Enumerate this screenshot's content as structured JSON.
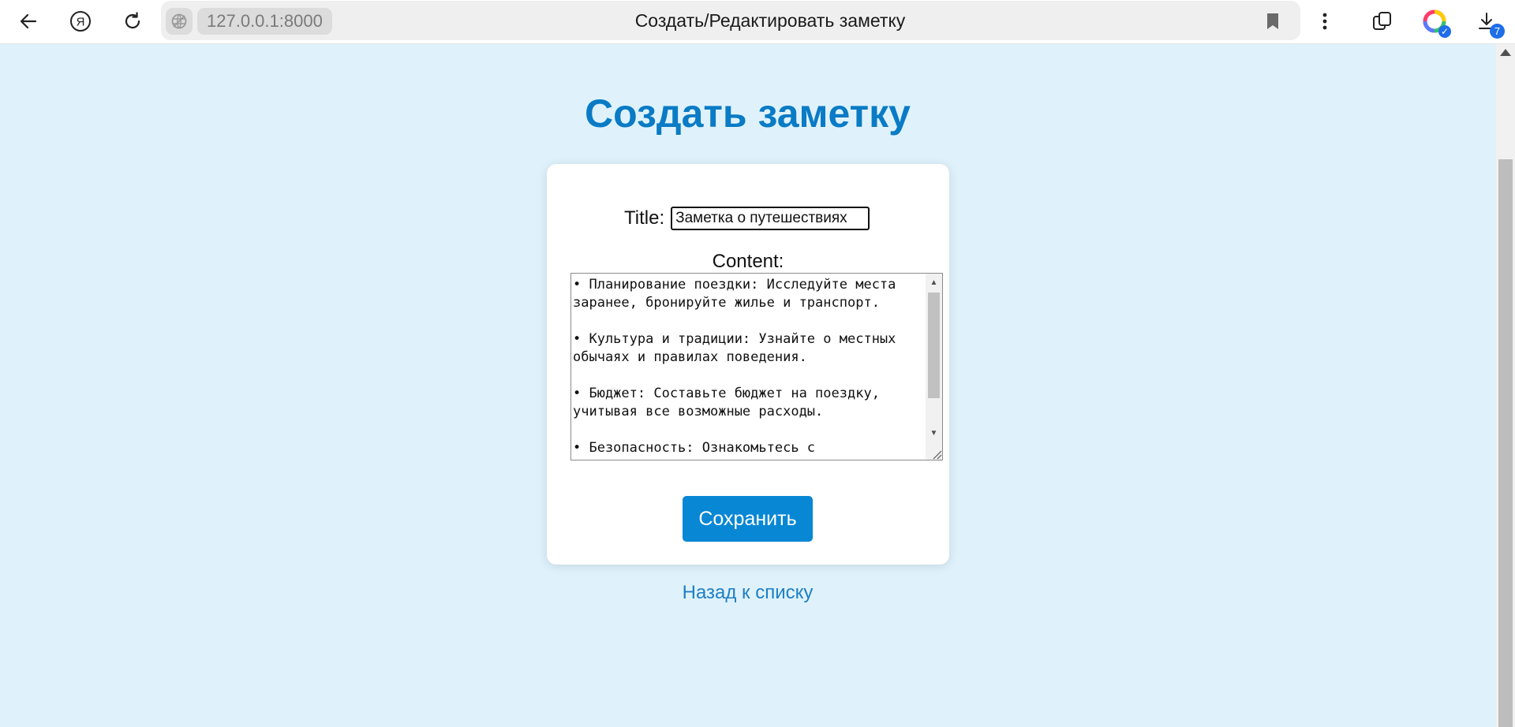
{
  "browser": {
    "url": "127.0.0.1:8000",
    "tab_title": "Создать/Редактировать заметку",
    "downloads_count": "7",
    "icons": {
      "back": "back-arrow-icon",
      "yandex": "yandex-logo-icon",
      "reload": "reload-icon",
      "site_info": "globe-icon",
      "bookmark": "bookmark-icon",
      "menu": "more-vertical-icon",
      "tabs": "tabs-icon",
      "alice": "alice-icon",
      "downloads": "download-icon"
    }
  },
  "page": {
    "heading": "Создать заметку",
    "title_label": "Title:",
    "title_value": "Заметка о путешествиях",
    "content_label": "Content:",
    "content_value": "• Планирование поездки: Исследуйте места заранее, бронируйте жилье и транспорт.\n\n• Культура и традиции: Узнайте о местных обычаях и правилах поведения.\n\n• Бюджет: Составьте бюджет на поездку, учитывая все возможные расходы.\n\n• Безопасность: Ознакомьтесь с",
    "save_label": "Сохранить",
    "back_link": "Назад к списку"
  },
  "colors": {
    "page_background": "#dff2fc",
    "heading": "#0a7bc5",
    "button": "#0787d4",
    "link": "#1e7fc4"
  }
}
